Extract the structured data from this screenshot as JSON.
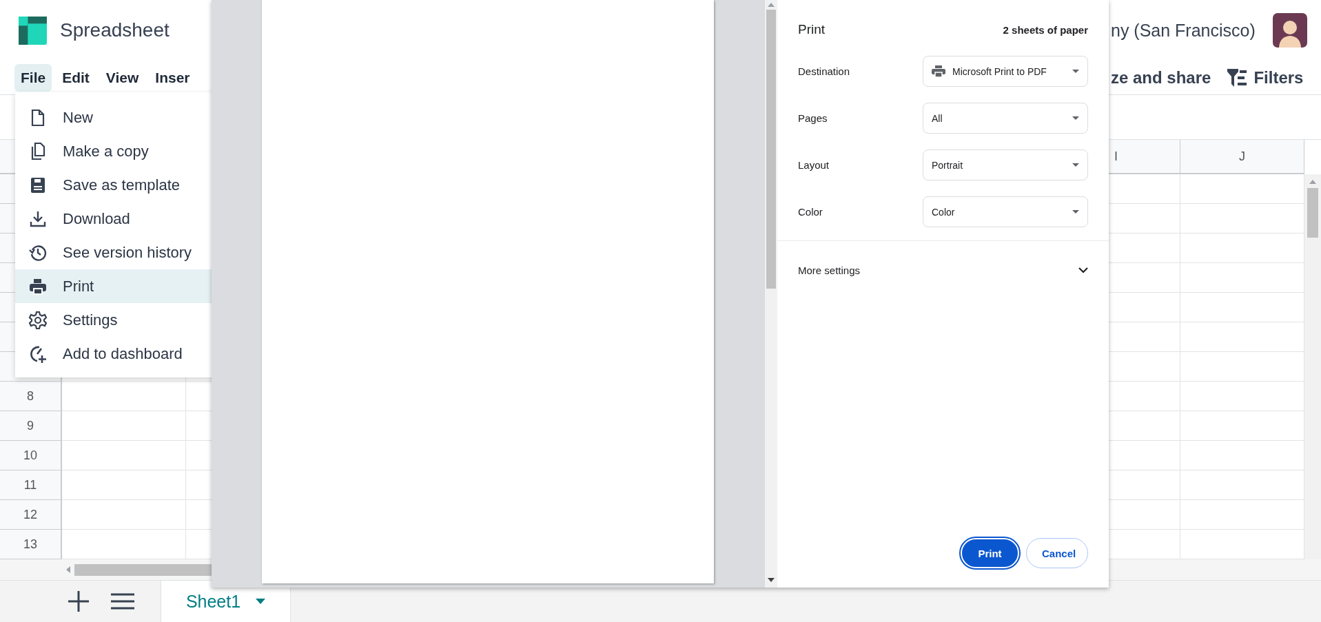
{
  "app": {
    "title": "Spreadsheet",
    "company": "ny (San Francisco)"
  },
  "menu_bar": [
    {
      "label": "File",
      "selected": true
    },
    {
      "label": "Edit",
      "selected": false
    },
    {
      "label": "View",
      "selected": false
    },
    {
      "label": "Inser",
      "selected": false
    }
  ],
  "toolbar": [
    {
      "label": "ze and share",
      "kind": "text"
    },
    {
      "label": "Filters",
      "kind": "filter"
    }
  ],
  "file_menu": [
    {
      "label": "New",
      "kind": "new",
      "selected": false
    },
    {
      "label": "Make a copy",
      "kind": "copy",
      "selected": false
    },
    {
      "label": "Save as template",
      "kind": "save",
      "selected": false
    },
    {
      "label": "Download",
      "kind": "download",
      "selected": false
    },
    {
      "label": "See version history",
      "kind": "history",
      "selected": false
    },
    {
      "label": "Print",
      "kind": "print",
      "selected": true
    },
    {
      "label": "Settings",
      "kind": "settings",
      "selected": false
    },
    {
      "label": "Add to dashboard",
      "kind": "dashboard",
      "selected": false
    }
  ],
  "grid": {
    "columns": [
      "I",
      "J"
    ],
    "row_numbers": [
      "8",
      "9",
      "10",
      "11",
      "12",
      "13"
    ]
  },
  "sheet_tabs": [
    {
      "label": "Sheet1",
      "selected": true
    }
  ],
  "print_dialog": {
    "title": "Print",
    "summary": "2 sheets of paper",
    "settings": [
      {
        "label": "Destination",
        "value": "Microsoft Print to PDF",
        "kind": "printer"
      },
      {
        "label": "Pages",
        "value": "All",
        "kind": "plain"
      },
      {
        "label": "Layout",
        "value": "Portrait",
        "kind": "plain"
      },
      {
        "label": "Color",
        "value": "Color",
        "kind": "plain"
      }
    ],
    "more": "More settings",
    "buttons": [
      {
        "label": "Print",
        "kind": "primary"
      },
      {
        "label": "Cancel",
        "kind": "secondary"
      }
    ]
  }
}
